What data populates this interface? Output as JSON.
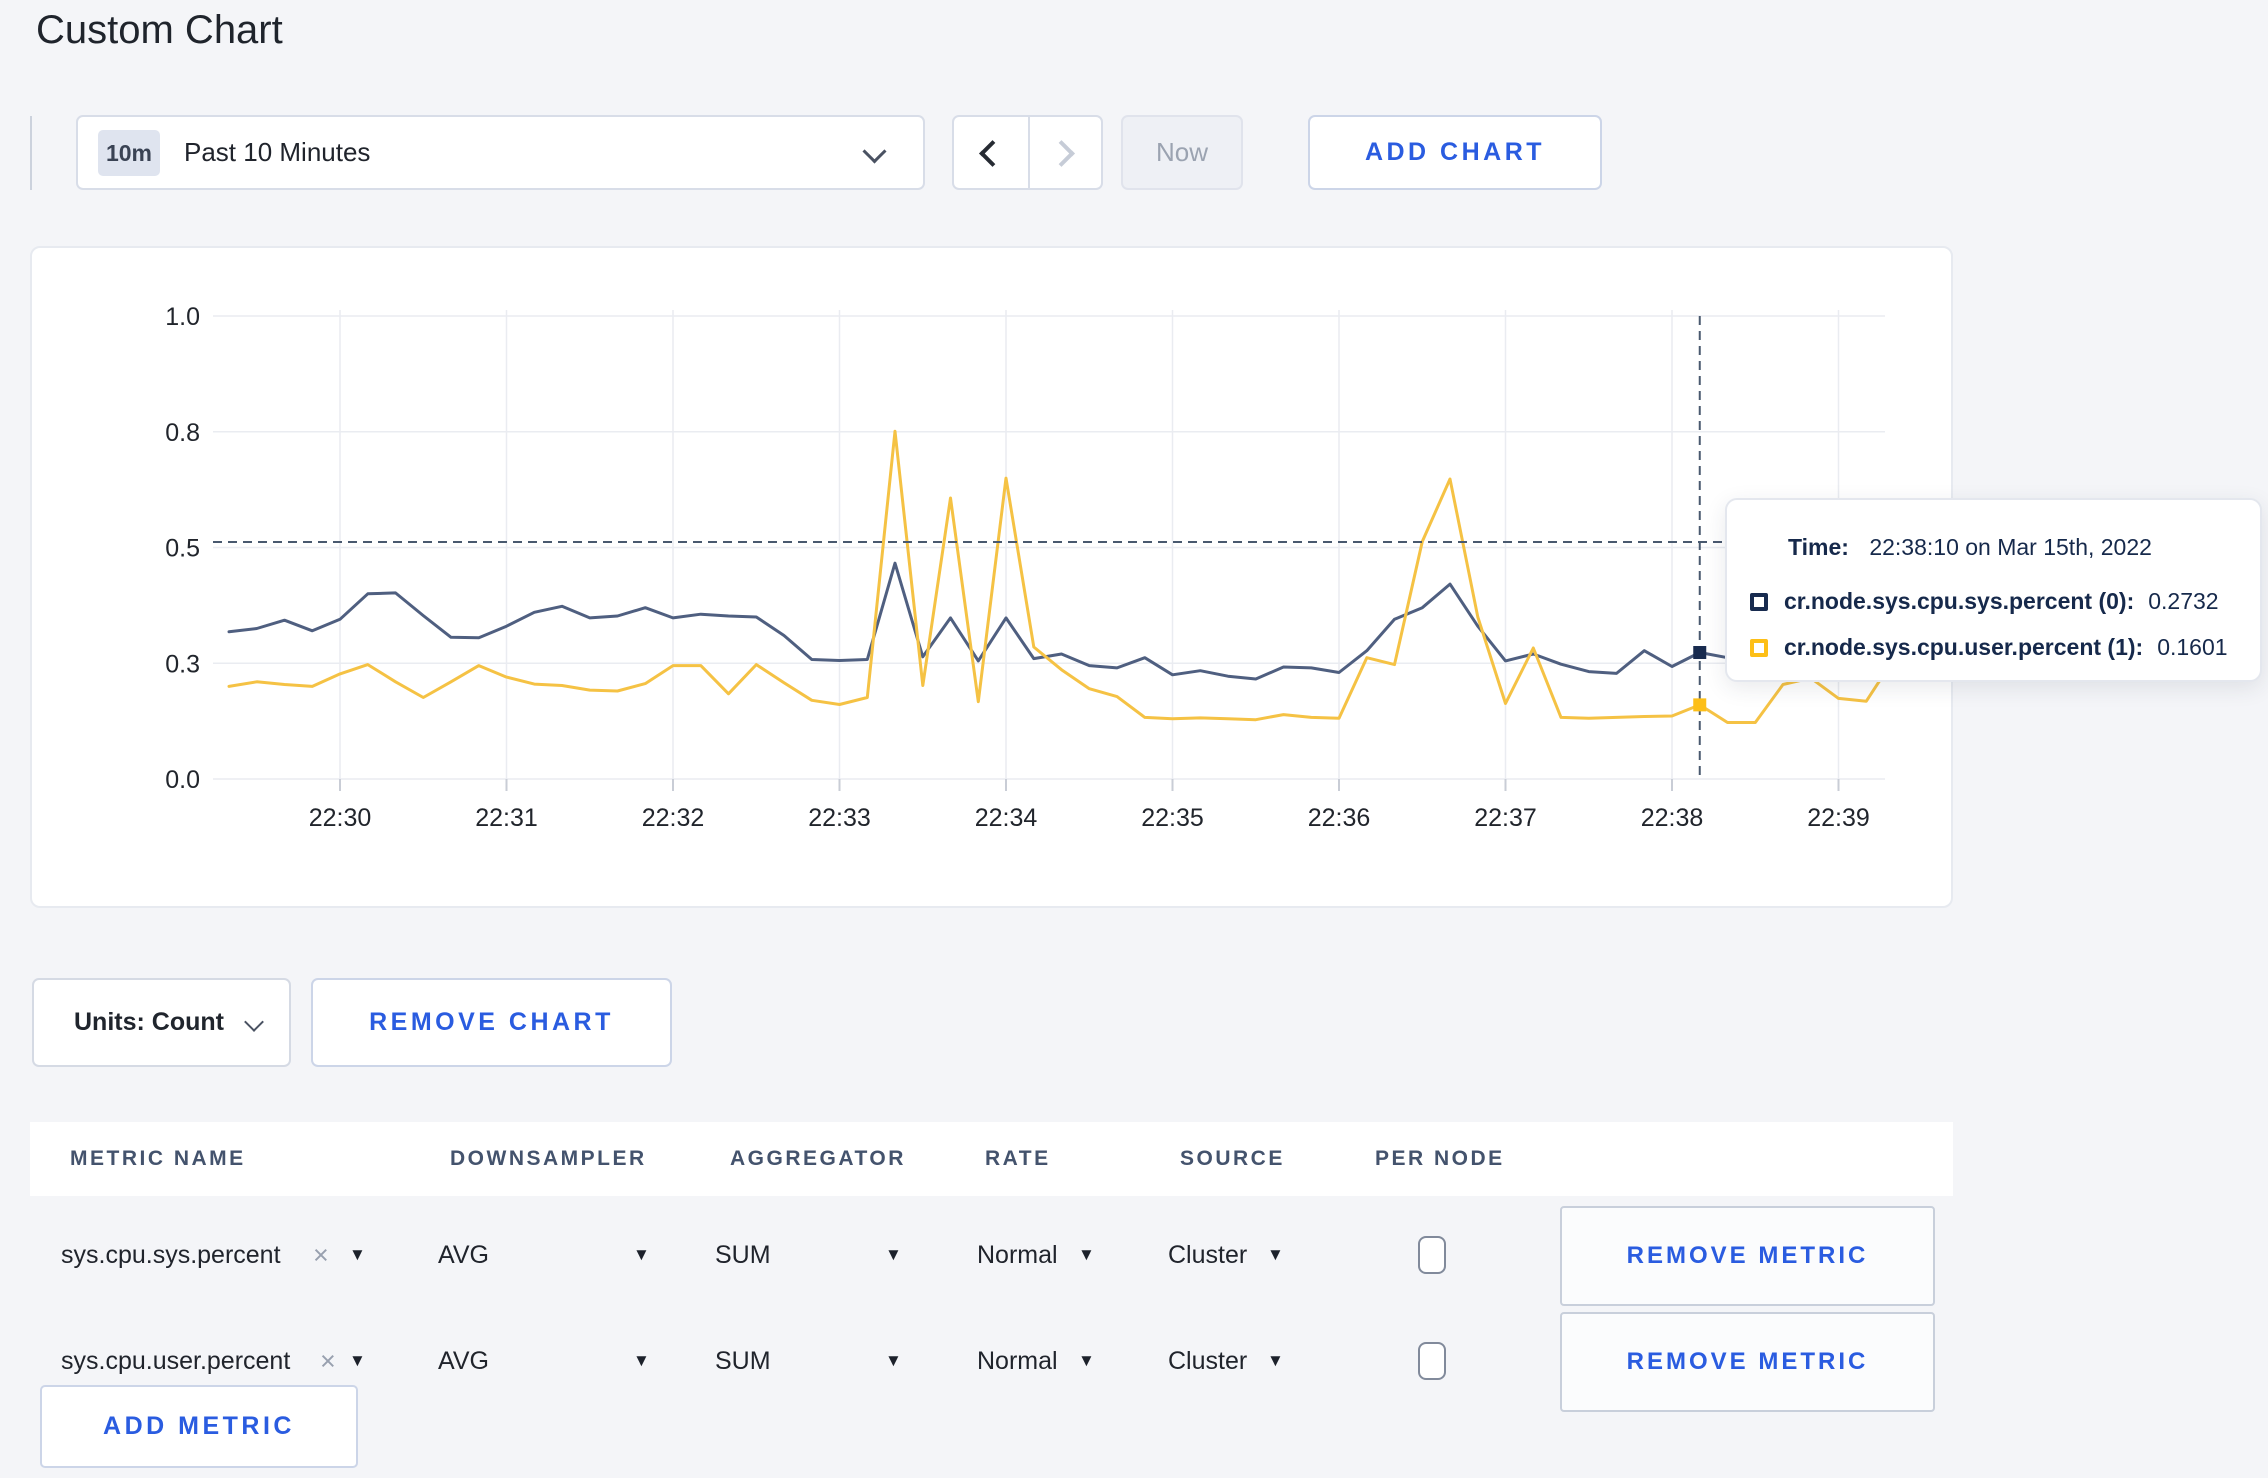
{
  "page": {
    "title": "Custom Chart",
    "background": "#f4f5f8",
    "accent_blue": "#2a5ce0"
  },
  "toolbar": {
    "range_badge": "10m",
    "range_label": "Past 10 Minutes",
    "now_label": "Now",
    "add_chart_label": "ADD CHART"
  },
  "chart": {
    "units_label": "Units: Count",
    "remove_chart_label": "REMOVE CHART",
    "tooltip": {
      "time_label": "Time:",
      "time_value": "22:38:10 on Mar 15th, 2022",
      "rows": [
        {
          "label": "cr.node.sys.cpu.sys.percent (0):",
          "value": "0.2732",
          "swatch_color": "#182b4f"
        },
        {
          "label": "cr.node.sys.cpu.user.percent (1):",
          "value": "0.1601",
          "swatch_color": "#fdbf17"
        }
      ]
    }
  },
  "chart_data": {
    "type": "line",
    "title": "",
    "xlabel": "",
    "ylabel": "",
    "ylim": [
      0,
      1
    ],
    "grid": true,
    "y_ticks": {
      "values": [
        0,
        0.25,
        0.5,
        0.75,
        1.0
      ],
      "labels": [
        "0.0",
        "0.3",
        "0.5",
        "0.8",
        "1.0"
      ]
    },
    "x_ticks": [
      "22:30",
      "22:31",
      "22:32",
      "22:33",
      "22:34",
      "22:35",
      "22:36",
      "22:37",
      "22:38",
      "22:39"
    ],
    "x": [
      "22:29:20",
      "22:29:30",
      "22:29:40",
      "22:29:50",
      "22:30:00",
      "22:30:10",
      "22:30:20",
      "22:30:30",
      "22:30:40",
      "22:30:50",
      "22:31:00",
      "22:31:10",
      "22:31:20",
      "22:31:30",
      "22:31:40",
      "22:31:50",
      "22:32:00",
      "22:32:10",
      "22:32:20",
      "22:32:30",
      "22:32:40",
      "22:32:50",
      "22:33:00",
      "22:33:10",
      "22:33:20",
      "22:33:30",
      "22:33:40",
      "22:33:50",
      "22:34:00",
      "22:34:10",
      "22:34:20",
      "22:34:30",
      "22:34:40",
      "22:34:50",
      "22:35:00",
      "22:35:10",
      "22:35:20",
      "22:35:30",
      "22:35:40",
      "22:35:50",
      "22:36:00",
      "22:36:10",
      "22:36:20",
      "22:36:30",
      "22:36:40",
      "22:36:50",
      "22:37:00",
      "22:37:10",
      "22:37:20",
      "22:37:30",
      "22:37:40",
      "22:37:50",
      "22:38:00",
      "22:38:10",
      "22:38:20",
      "22:38:30",
      "22:38:40",
      "22:38:50",
      "22:39:00",
      "22:39:10",
      "22:39:20"
    ],
    "series": [
      {
        "name": "cr.node.sys.cpu.sys.percent",
        "color": "#4f5f80",
        "swatch": "#182b4f",
        "values": [
          0.318,
          0.325,
          0.343,
          0.32,
          0.345,
          0.4,
          0.402,
          0.353,
          0.306,
          0.305,
          0.33,
          0.36,
          0.373,
          0.348,
          0.352,
          0.37,
          0.348,
          0.356,
          0.352,
          0.35,
          0.31,
          0.258,
          0.256,
          0.258,
          0.466,
          0.264,
          0.348,
          0.255,
          0.348,
          0.26,
          0.27,
          0.245,
          0.24,
          0.262,
          0.225,
          0.234,
          0.222,
          0.216,
          0.242,
          0.24,
          0.23,
          0.277,
          0.345,
          0.37,
          0.421,
          0.33,
          0.255,
          0.27,
          0.248,
          0.232,
          0.228,
          0.277,
          0.243,
          0.2732,
          0.262,
          0.27,
          0.262,
          0.268,
          0.274,
          0.27,
          0.265
        ]
      },
      {
        "name": "cr.node.sys.cpu.user.percent",
        "color": "#f5c244",
        "swatch": "#fdbf17",
        "values": [
          0.2,
          0.21,
          0.204,
          0.2,
          0.227,
          0.247,
          0.21,
          0.176,
          0.21,
          0.245,
          0.22,
          0.205,
          0.202,
          0.192,
          0.19,
          0.206,
          0.245,
          0.245,
          0.184,
          0.247,
          0.208,
          0.17,
          0.161,
          0.176,
          0.751,
          0.202,
          0.607,
          0.167,
          0.65,
          0.285,
          0.236,
          0.195,
          0.178,
          0.133,
          0.13,
          0.132,
          0.13,
          0.128,
          0.139,
          0.133,
          0.131,
          0.262,
          0.247,
          0.513,
          0.648,
          0.35,
          0.163,
          0.283,
          0.133,
          0.131,
          0.133,
          0.135,
          0.136,
          0.1601,
          0.122,
          0.122,
          0.204,
          0.218,
          0.174,
          0.168,
          0.26
        ]
      }
    ],
    "crosshair": {
      "index": 53,
      "time": "22:38:10",
      "hover_y_value": 0.512
    }
  },
  "table": {
    "headers": [
      "METRIC NAME",
      "DOWNSAMPLER",
      "AGGREGATOR",
      "RATE",
      "SOURCE",
      "PER NODE"
    ],
    "rows": [
      {
        "metric": "sys.cpu.sys.percent",
        "downsampler": "AVG",
        "aggregator": "SUM",
        "rate": "Normal",
        "source": "Cluster",
        "per_node_checked": false
      },
      {
        "metric": "sys.cpu.user.percent",
        "downsampler": "AVG",
        "aggregator": "SUM",
        "rate": "Normal",
        "source": "Cluster",
        "per_node_checked": false
      }
    ],
    "remove_metric_label": "REMOVE METRIC",
    "add_metric_label": "ADD METRIC",
    "caret_glyph": "▼",
    "clear_glyph": "×"
  }
}
